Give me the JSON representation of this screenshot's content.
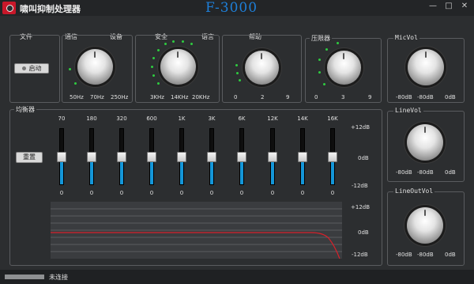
{
  "app": {
    "title": "啸叫抑制处理器",
    "model": "F-3000",
    "model_color": "#1e7fd8"
  },
  "window_buttons": {
    "minimize": "—",
    "maximize": "□",
    "close": "✕"
  },
  "menu": {
    "file": "文件",
    "comm": "通信",
    "device": "设备",
    "security": "安全",
    "language": "语言",
    "help": "帮助"
  },
  "start_button": "启动",
  "knobs": [
    {
      "name": "freq-knob",
      "ticks": [
        "50Hz",
        "70Hz",
        "250Hz"
      ]
    },
    {
      "name": "hf-knob",
      "ticks": [
        "3KHz",
        "14KHz",
        "20KHz"
      ]
    },
    {
      "name": "help-knob",
      "ticks": [
        "0",
        "2",
        "9"
      ]
    },
    {
      "name": "limiter-knob",
      "ticks": [
        "0",
        "3",
        "9"
      ]
    }
  ],
  "limiter": {
    "title": "压限器"
  },
  "equalizer": {
    "title": "均衡器",
    "reset_button": "重置",
    "bands": [
      {
        "freq": "70",
        "value": "0"
      },
      {
        "freq": "180",
        "value": "0"
      },
      {
        "freq": "320",
        "value": "0"
      },
      {
        "freq": "600",
        "value": "0"
      },
      {
        "freq": "1K",
        "value": "0"
      },
      {
        "freq": "3K",
        "value": "0"
      },
      {
        "freq": "6K",
        "value": "0"
      },
      {
        "freq": "12K",
        "value": "0"
      },
      {
        "freq": "14K",
        "value": "0"
      },
      {
        "freq": "16K",
        "value": "0"
      }
    ],
    "scale": {
      "top": "+12dB",
      "mid": "0dB",
      "bottom": "-12dB"
    },
    "graph_scale": {
      "top": "+12dB",
      "mid": "0dB",
      "bottom": "-12dB"
    }
  },
  "mic_vol": {
    "title": "MicVol",
    "ticks": [
      "-80dB",
      "-80dB",
      "0dB"
    ]
  },
  "line_vol": {
    "title": "LineVol",
    "ticks": [
      "-80dB",
      "-80dB",
      "0dB"
    ]
  },
  "lineout_vol": {
    "title": "LineOutVol",
    "ticks": [
      "-80dB",
      "-80dB",
      "0dB"
    ]
  },
  "status": {
    "text": "未连接",
    "progress": 1.0
  },
  "colors": {
    "accent": "#1496d8",
    "curve": "#d8202a",
    "led": "#2ecc40"
  }
}
